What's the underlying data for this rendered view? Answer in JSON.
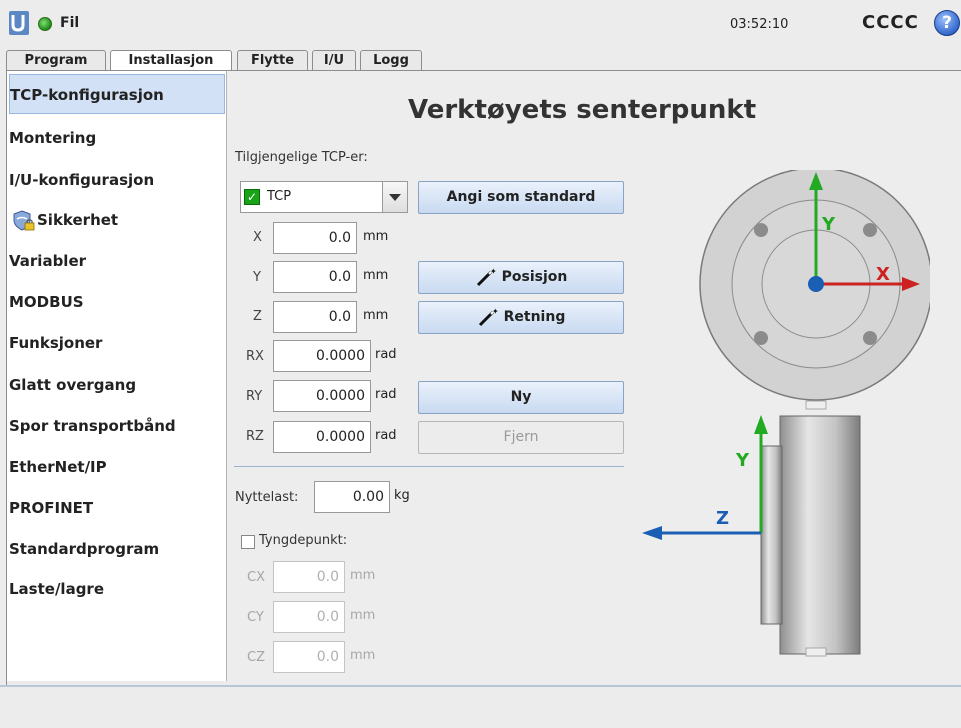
{
  "header": {
    "file_menu": "Fil",
    "clock": "03:52:10",
    "robot_name": "CCCC",
    "help": "?"
  },
  "tabs": [
    {
      "label": "Program",
      "active": false
    },
    {
      "label": "Installasjon",
      "active": true
    },
    {
      "label": "Flytte",
      "active": false
    },
    {
      "label": "I/U",
      "active": false
    },
    {
      "label": "Logg",
      "active": false
    }
  ],
  "sidebar": {
    "items": [
      {
        "label": "TCP-konfigurasjon",
        "active": true
      },
      {
        "label": "Montering"
      },
      {
        "label": "I/U-konfigurasjon"
      },
      {
        "label": "Sikkerhet",
        "icon": "shield-lock-icon"
      },
      {
        "label": "Variabler"
      },
      {
        "label": "MODBUS"
      },
      {
        "label": "Funksjoner"
      },
      {
        "label": "Glatt overgang"
      },
      {
        "label": "Spor transportbånd"
      },
      {
        "label": "EtherNet/IP"
      },
      {
        "label": "PROFINET"
      },
      {
        "label": "Standardprogram"
      },
      {
        "label": "Laste/lagre"
      }
    ]
  },
  "main": {
    "title": "Verktøyets senterpunkt",
    "available_label": "Tilgjengelige TCP-er:",
    "tcp_selected": "TCP",
    "set_default_button": "Angi som standard",
    "position_button": "Posisjon",
    "orientation_button": "Retning",
    "new_button": "Ny",
    "remove_button": "Fjern",
    "fields": [
      {
        "label": "X",
        "value": "0.0",
        "unit": "mm"
      },
      {
        "label": "Y",
        "value": "0.0",
        "unit": "mm"
      },
      {
        "label": "Z",
        "value": "0.0",
        "unit": "mm"
      },
      {
        "label": "RX",
        "value": "0.0000",
        "unit": "rad"
      },
      {
        "label": "RY",
        "value": "0.0000",
        "unit": "rad"
      },
      {
        "label": "RZ",
        "value": "0.0000",
        "unit": "rad"
      }
    ],
    "payload": {
      "label": "Nyttelast:",
      "value": "0.00",
      "unit": "kg"
    },
    "cog": {
      "label": "Tyngdepunkt:",
      "checked": false
    },
    "cog_fields": [
      {
        "label": "CX",
        "value": "0.0",
        "unit": "mm"
      },
      {
        "label": "CY",
        "value": "0.0",
        "unit": "mm"
      },
      {
        "label": "CZ",
        "value": "0.0",
        "unit": "mm"
      }
    ]
  },
  "diagram": {
    "top_axes": {
      "y": "Y",
      "x": "X"
    },
    "side_axes": {
      "y": "Y",
      "z": "Z"
    },
    "colors": {
      "y_axis": "#22aa22",
      "x_axis": "#cc2222",
      "z_axis": "#1a5fb4",
      "origin": "#1a5fb4"
    }
  }
}
